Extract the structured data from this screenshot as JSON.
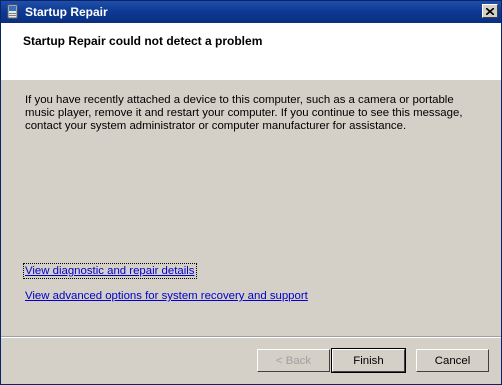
{
  "window": {
    "title": "Startup Repair",
    "close_label": "×"
  },
  "header": {
    "title": "Startup Repair could not detect a problem"
  },
  "body": {
    "message": "If you have recently attached a device to this computer, such as a camera or portable music player, remove it and restart your computer. If you continue to see this message, contact your system administrator or computer manufacturer for assistance."
  },
  "links": {
    "diagnostic": "View diagnostic and repair details",
    "advanced": "View advanced options for system recovery and support"
  },
  "buttons": {
    "back": "< Back",
    "finish": "Finish",
    "cancel": "Cancel"
  }
}
